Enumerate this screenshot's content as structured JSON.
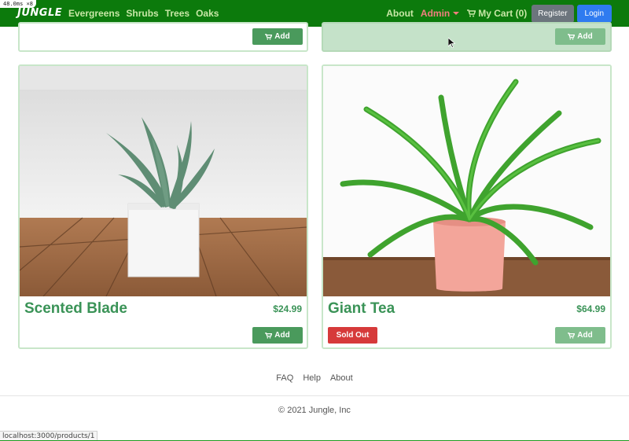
{
  "debug_tag": "48.0ms ×8",
  "navbar": {
    "brand": "JUNGLE",
    "categories": [
      "Evergreens",
      "Shrubs",
      "Trees",
      "Oaks"
    ],
    "about": "About",
    "admin": "Admin",
    "cart": "My Cart (0)",
    "register": "Register",
    "login": "Login"
  },
  "top_cards": [
    {
      "add_label": "Add"
    },
    {
      "add_label": "Add"
    }
  ],
  "products": [
    {
      "name": "Scented Blade",
      "price": "$24.99",
      "add_label": "Add",
      "sold_out": false
    },
    {
      "name": "Giant Tea",
      "price": "$64.99",
      "add_label": "Add",
      "sold_out": true,
      "sold_out_label": "Sold Out"
    }
  ],
  "footer": {
    "links": [
      "FAQ",
      "Help",
      "About"
    ],
    "copyright": "© 2021 Jungle, Inc"
  },
  "status_url": "localhost:3000/products/1",
  "colors": {
    "navbar": "#0c7a0c",
    "nav_link": "#c7e7a6",
    "admin": "#f07f7f",
    "product_text": "#3a9357",
    "add_button": "#4a9a5c",
    "sold_out": "#d63a3a",
    "login": "#2f7bf0",
    "register": "#6c757d"
  },
  "icons": [
    "cart-icon",
    "caret-down-icon",
    "mouse-pointer-icon"
  ]
}
